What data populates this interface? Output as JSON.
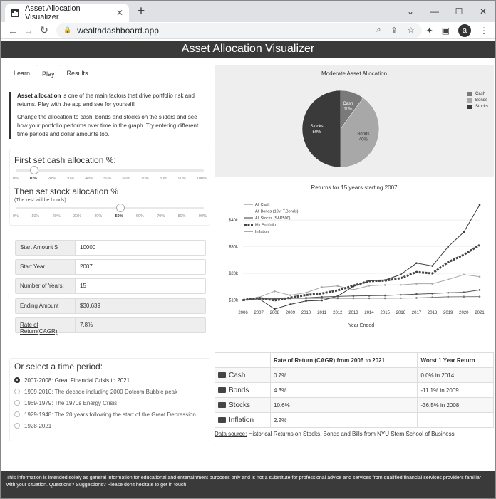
{
  "browser": {
    "tab_title": "Asset Allocation Visualizer",
    "url": "wealthdashboard.app",
    "avatar_letter": "a"
  },
  "app": {
    "title": "Asset Allocation Visualizer"
  },
  "tabs": [
    {
      "label": "Learn"
    },
    {
      "label": "Play"
    },
    {
      "label": "Results"
    }
  ],
  "intro": {
    "bold": "Asset allocation",
    "p1": " is one of the main factors that drive portfolio risk and returns. Play with the app and see for yourself!",
    "p2": "Change the allocation to cash, bonds and stocks on the sliders and see how your portfolio performs over time in the graph. Try entering different time periods and dollar amounts too."
  },
  "sliders": {
    "cash_label": "First set cash allocation %:",
    "cash_value": 10,
    "cash_ticks": [
      "0%",
      "10%",
      "20%",
      "30%",
      "40%",
      "50%",
      "60%",
      "70%",
      "80%",
      "90%",
      "100%"
    ],
    "stock_label": "Then set stock allocation %",
    "stock_sub": "(The rest will be bonds)",
    "stock_value": 50,
    "stock_max": 90,
    "stock_ticks": [
      "0%",
      "10%",
      "20%",
      "30%",
      "40%",
      "50%",
      "60%",
      "70%",
      "80%",
      "90%"
    ]
  },
  "inputs": {
    "start_amount_label": "Start Amount $",
    "start_amount": "10000",
    "start_year_label": "Start Year",
    "start_year": "2007",
    "num_years_label": "Number of Years:",
    "num_years": "15",
    "ending_label": "Ending Amount",
    "ending_value": "$30,639",
    "ror_label_a": "Rate of Return",
    "ror_label_b": "(CAGR)",
    "ror_value": "7.8%"
  },
  "periods": {
    "title": "Or select a time period:",
    "options": [
      "2007-2008: Great Financial Crisis to 2021",
      "1999-2010: The decade including 2000 Dotcom Bubble peak",
      "1969-1979: The 1970s Energy Crisis",
      "1929-1948: The 20 years following the start of the Great Depression",
      "1928-2021"
    ],
    "selected": 0
  },
  "colors": {
    "cash": "#7a7a7a",
    "bonds": "#a8a8a8",
    "stocks": "#3a3a3a",
    "portfolio": "#444444",
    "inflation": "#555555",
    "header": "#3a3a3a"
  },
  "chart_data": [
    {
      "type": "pie",
      "title": "Moderate Asset Allocation",
      "categories": [
        "Cash",
        "Bonds",
        "Stocks"
      ],
      "values": [
        10,
        40,
        50
      ],
      "labels": [
        "10%",
        "40%",
        "50%"
      ],
      "legend": "right"
    },
    {
      "type": "line",
      "title": "Returns for 15 years starting 2007",
      "xlabel": "Year Ended",
      "x": [
        2006,
        2007,
        2008,
        2009,
        2010,
        2011,
        2012,
        2013,
        2014,
        2015,
        2016,
        2017,
        2018,
        2019,
        2020,
        2021
      ],
      "yticks": [
        "$10k",
        "$20k",
        "$30k",
        "$40k"
      ],
      "ylim": [
        8000,
        47000
      ],
      "legend": "top-left",
      "series": [
        {
          "name": "All Cash",
          "values": [
            10000,
            10470,
            10630,
            10640,
            10650,
            10660,
            10670,
            10680,
            10690,
            10700,
            10730,
            10820,
            11010,
            11230,
            11280,
            11290
          ]
        },
        {
          "name": "All Bonds (10yr T.Bonds)",
          "values": [
            10000,
            11020,
            13300,
            11810,
            12770,
            14850,
            15290,
            13880,
            15370,
            15640,
            15690,
            16130,
            16130,
            17690,
            19520,
            18770
          ]
        },
        {
          "name": "All Stocks (S&P500)",
          "values": [
            10000,
            10540,
            6640,
            8400,
            9670,
            9870,
            11450,
            15160,
            17230,
            17480,
            19580,
            23850,
            22800,
            29990,
            35510,
            45710
          ]
        },
        {
          "name": "My Portfolio",
          "values": [
            10000,
            10800,
            9900,
            10900,
            11900,
            12500,
            13600,
            15400,
            17100,
            17300,
            18200,
            20500,
            20000,
            24200,
            27000,
            30639
          ]
        },
        {
          "name": "Inflation",
          "values": [
            10000,
            10410,
            10410,
            10690,
            10850,
            11170,
            11370,
            11540,
            11630,
            11710,
            11960,
            12220,
            12450,
            12740,
            12910,
            13790
          ]
        }
      ]
    }
  ],
  "table": {
    "headers": [
      "",
      "Rate of Return (CAGR) from 2006 to 2021",
      "Worst 1 Year Return"
    ],
    "rows": [
      [
        "Cash",
        "0.7%",
        "0.0% in 2014"
      ],
      [
        "Bonds",
        "4.3%",
        "-11.1% in 2009"
      ],
      [
        "Stocks",
        "10.6%",
        "-36.5% in 2008"
      ],
      [
        "Inflation",
        "2.2%",
        ""
      ]
    ]
  },
  "source": {
    "label": "Data source:",
    "text": " Historical Returns on Stocks, Bonds and Bills from NYU Stern School of Business"
  },
  "footer": "This information is intended solely as general information for educational and entertainment purposes only and is not a substitute for professional advice and services from qualified financial services providers familiar with your situation. Questions? Suggestions? Please don't hesitate to get in touch:"
}
